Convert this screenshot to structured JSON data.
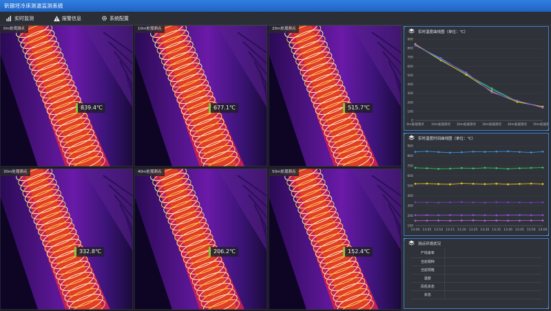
{
  "app": {
    "title": "钒钢坯冷床测温监测系统"
  },
  "toolbar": {
    "items": [
      {
        "label": "实时监测",
        "icon": "bar-chart-icon"
      },
      {
        "label": "报警信息",
        "icon": "warning-icon"
      },
      {
        "label": "系统配置",
        "icon": "gear-icon"
      }
    ]
  },
  "cameras": [
    {
      "label": "0m处观测点",
      "temp": "839.4℃"
    },
    {
      "label": "10m处观测点",
      "temp": "677.1℃"
    },
    {
      "label": "20m处观测点",
      "temp": "515.7℃"
    },
    {
      "label": "30m处观测点",
      "temp": "332.8℃"
    },
    {
      "label": "40m处观测点",
      "temp": "206.2℃"
    },
    {
      "label": "50m处观测点",
      "temp": "152.4℃"
    }
  ],
  "panels": {
    "position_chart": {
      "title": "实时温度曲线图（单位：℃）"
    },
    "time_chart": {
      "title": "实时温度时间曲线图（单位：℃）"
    },
    "env": {
      "title": "测点环境状况"
    }
  },
  "env_table": {
    "rows": [
      {
        "label": "产线速率",
        "value": ""
      },
      {
        "label": "当前钢种",
        "value": ""
      },
      {
        "label": "当前规格",
        "value": ""
      },
      {
        "label": "温度",
        "value": ""
      },
      {
        "label": "风机状态",
        "value": ""
      },
      {
        "label": "状态",
        "value": ""
      }
    ]
  },
  "colors": {
    "accent": "#3f7fd0",
    "series_blue": "#3b8fe0",
    "series_green": "#35c45a",
    "series_yellow": "#e6c324",
    "series_purple": "#8a52d9",
    "series_violet": "#6f3fc0"
  },
  "chart_data": [
    {
      "type": "line",
      "categories": [
        "0m处观测点",
        "10m处观测点",
        "20m处观测点",
        "30m处观测点",
        "40m处观测点",
        "50m处观测点"
      ],
      "series": [
        {
          "values": [
            830,
            690,
            520,
            340,
            215,
            150
          ],
          "color": "#3b8fe0"
        },
        {
          "values": [
            840,
            665,
            510,
            355,
            210,
            148
          ],
          "color": "#35c45a"
        },
        {
          "values": [
            845,
            670,
            505,
            320,
            205,
            152
          ],
          "color": "#e6c324"
        },
        {
          "values": [
            835,
            680,
            530,
            310,
            220,
            140
          ],
          "color": "#8a52d9"
        }
      ],
      "ylim": [
        0,
        900
      ],
      "yticks": [
        0,
        100,
        200,
        300,
        400,
        500,
        600,
        700,
        800,
        900
      ]
    },
    {
      "type": "line",
      "categories": [
        "13:00",
        "13:05",
        "13:10",
        "13:15",
        "13:20",
        "13:25",
        "13:30",
        "13:35",
        "13:40",
        "13:45",
        "13:50",
        "14:00"
      ],
      "series": [
        {
          "values": [
            840,
            845,
            838,
            832,
            836,
            842,
            840,
            843,
            845,
            839,
            834,
            842
          ],
          "color": "#3b8fe0"
        },
        {
          "values": [
            680,
            676,
            670,
            672,
            678,
            674,
            680,
            677,
            670,
            676,
            679,
            682
          ],
          "color": "#35c45a"
        },
        {
          "values": [
            520,
            522,
            518,
            515,
            524,
            520,
            517,
            521,
            515,
            519,
            522,
            518
          ],
          "color": "#e6c324"
        },
        {
          "values": [
            335,
            333,
            332,
            334,
            336,
            333,
            332,
            335,
            334,
            333,
            332,
            334
          ],
          "color": "#6f3fc0"
        },
        {
          "values": [
            205,
            206,
            204,
            207,
            205,
            206,
            205,
            204,
            206,
            207,
            205,
            206
          ],
          "color": "#8a52d9"
        },
        {
          "values": [
            150,
            151,
            152,
            150,
            152,
            153,
            151,
            152,
            150,
            151,
            152,
            152
          ],
          "color": "#b05fd0"
        }
      ],
      "ylim": [
        100,
        900
      ],
      "yticks": [
        100,
        200,
        300,
        400,
        500,
        600,
        700,
        800,
        900
      ]
    }
  ]
}
